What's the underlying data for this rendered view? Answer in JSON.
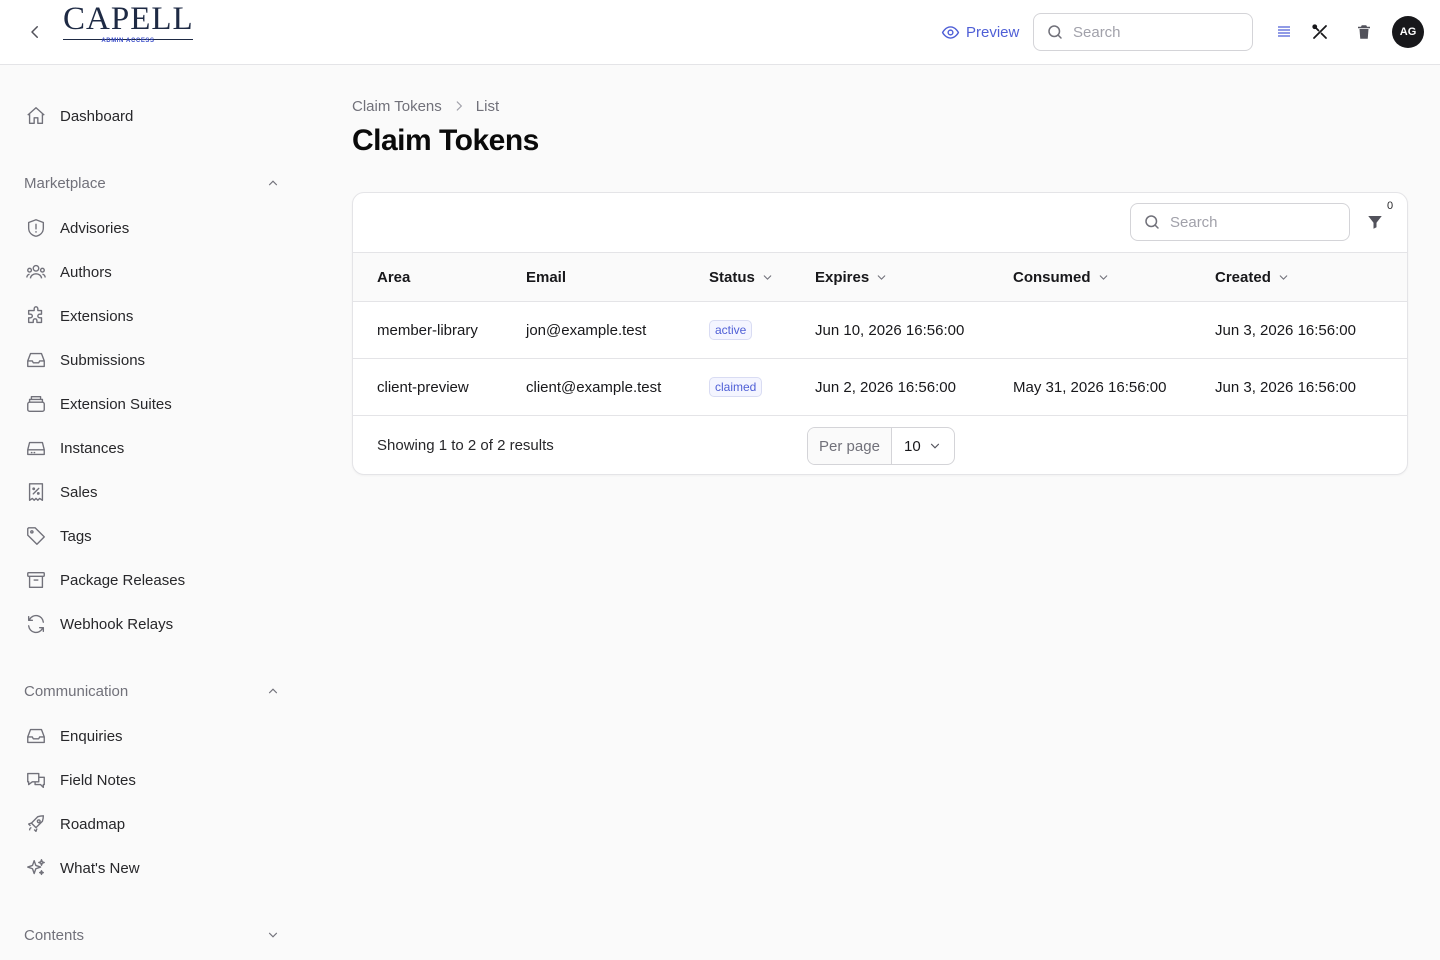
{
  "logo": {
    "name": "CAPELL",
    "tagline": "ADMIN ACCESS"
  },
  "topbar": {
    "preview_label": "Preview",
    "search_placeholder": "Search",
    "avatar_initials": "AG"
  },
  "sidebar": {
    "dashboard": {
      "label": "Dashboard",
      "icon": "home-icon"
    },
    "groups": [
      {
        "label": "Marketplace",
        "expanded": true,
        "items": [
          {
            "label": "Advisories",
            "icon": "shield-exclamation-icon"
          },
          {
            "label": "Authors",
            "icon": "users-icon"
          },
          {
            "label": "Extensions",
            "icon": "puzzle-icon"
          },
          {
            "label": "Submissions",
            "icon": "inbox-icon"
          },
          {
            "label": "Extension Suites",
            "icon": "stack-icon"
          },
          {
            "label": "Instances",
            "icon": "server-icon"
          },
          {
            "label": "Sales",
            "icon": "receipt-percent-icon"
          },
          {
            "label": "Tags",
            "icon": "tag-icon"
          },
          {
            "label": "Package Releases",
            "icon": "archive-box-icon"
          },
          {
            "label": "Webhook Relays",
            "icon": "refresh-icon"
          }
        ]
      },
      {
        "label": "Communication",
        "expanded": true,
        "items": [
          {
            "label": "Enquiries",
            "icon": "inbox-icon"
          },
          {
            "label": "Field Notes",
            "icon": "chat-bubbles-icon"
          },
          {
            "label": "Roadmap",
            "icon": "rocket-icon"
          },
          {
            "label": "What's New",
            "icon": "sparkles-icon"
          }
        ]
      },
      {
        "label": "Contents",
        "expanded": false,
        "items": []
      }
    ]
  },
  "breadcrumb": {
    "root": "Claim Tokens",
    "current": "List"
  },
  "page_title": "Claim Tokens",
  "table": {
    "search_placeholder": "Search",
    "filter_count": "0",
    "columns": [
      {
        "label": "Area",
        "sortable": false
      },
      {
        "label": "Email",
        "sortable": false
      },
      {
        "label": "Status",
        "sortable": true
      },
      {
        "label": "Expires",
        "sortable": true
      },
      {
        "label": "Consumed",
        "sortable": true
      },
      {
        "label": "Created",
        "sortable": true
      }
    ],
    "rows": [
      {
        "area": "member-library",
        "email": "jon@example.test",
        "status": "active",
        "expires": "Jun 10, 2026 16:56:00",
        "consumed": "",
        "created": "Jun 3, 2026 16:56:00"
      },
      {
        "area": "client-preview",
        "email": "client@example.test",
        "status": "claimed",
        "expires": "Jun 2, 2026 16:56:00",
        "consumed": "May 31, 2026 16:56:00",
        "created": "Jun 3, 2026 16:56:00"
      }
    ],
    "footer_text": "Showing 1 to 2 of 2 results",
    "per_page_label": "Per page",
    "per_page_value": "10"
  },
  "colors": {
    "accent": "#4f5fd6",
    "text": "#18181b",
    "muted": "#71717a",
    "border": "#e4e4e7",
    "background": "#fafafa"
  }
}
